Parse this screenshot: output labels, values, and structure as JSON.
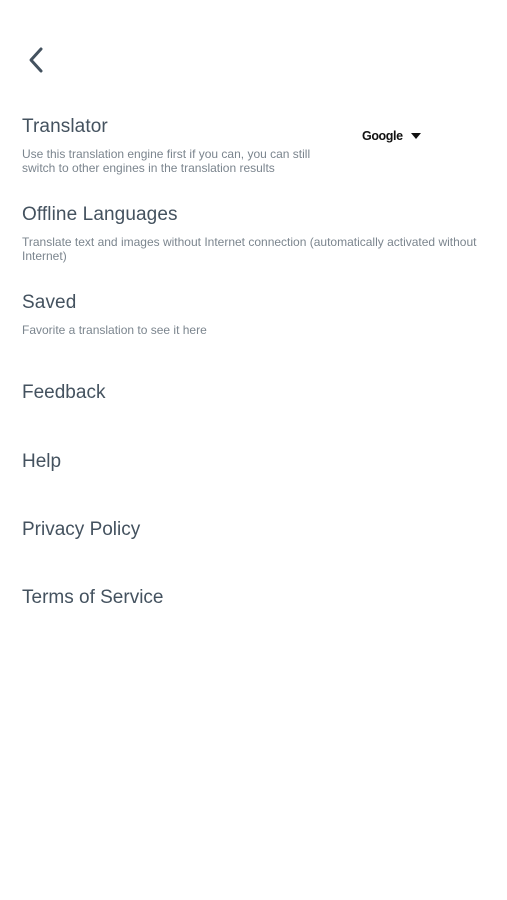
{
  "nav": {
    "back_icon": "chevron-left-icon",
    "back_color": "#44525f"
  },
  "translator": {
    "title": "Translator",
    "description": "Use this translation engine first if you can, you can still switch to other engines in the translation results",
    "selected_engine": "Google",
    "dropdown_icon": "caret-down-icon"
  },
  "offline_languages": {
    "title": "Offline Languages",
    "description": "Translate text and images without Internet connection (automatically activated without Internet)"
  },
  "saved": {
    "title": "Saved",
    "description": "Favorite a translation to see it here"
  },
  "menu": {
    "feedback": "Feedback",
    "help": "Help",
    "privacy_policy": "Privacy Policy",
    "terms_of_service": "Terms of Service"
  },
  "colors": {
    "title_text": "#44525f",
    "description_text": "#7b858e",
    "background": "#ffffff"
  }
}
